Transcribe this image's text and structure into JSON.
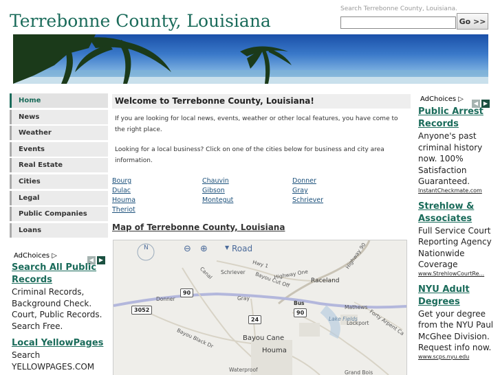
{
  "header": {
    "title": "Terrebonne County, Louisiana",
    "search_label": "Search Terrebonne County, Louisiana.",
    "search_value": "",
    "go_label": "Go >>"
  },
  "nav": {
    "items": [
      {
        "label": "Home",
        "active": true
      },
      {
        "label": "News"
      },
      {
        "label": "Weather"
      },
      {
        "label": "Events"
      },
      {
        "label": "Real Estate"
      },
      {
        "label": "Cities"
      },
      {
        "label": "Legal"
      },
      {
        "label": "Public Companies"
      },
      {
        "label": "Loans"
      }
    ]
  },
  "adchoices_label": "AdChoices",
  "left_ads": [
    {
      "title": "Search All Public Records",
      "body": "Criminal Records, Background Check. Court, Public Records. Search Free."
    },
    {
      "title": "Local YellowPages",
      "body": "Search YELLOWPAGES.COM"
    }
  ],
  "right_ads": [
    {
      "title": "Public Arrest Records",
      "body": "Anyone's past criminal history now. 100% Satisfaction Guaranteed.",
      "url": "InstantCheckmate.com"
    },
    {
      "title": "Strehlow & Associates",
      "body": "Full Service Court Reporting Agency Nationwide Coverage",
      "url": "www.StrehlowCourtRe..."
    },
    {
      "title": "NYU Adult Degrees",
      "body": "Get your degree from the NYU Paul McGhee Division. Request info now.",
      "url": "www.scps.nyu.edu"
    }
  ],
  "main": {
    "welcome": "Welcome to Terrebonne County, Louisiana!",
    "intro_1": "If you are looking for local news, events, weather or other local features, you have come to the right place.",
    "intro_2": "Looking for a local business? Click on one of the cities below for business and city area information.",
    "cities": [
      "Bourg",
      "Chauvin",
      "Donner",
      "Dulac",
      "Gibson",
      "Gray",
      "Houma",
      "Montegut",
      "Schriever",
      "Theriot"
    ],
    "map_title": "Map of Terrebonne County, Louisiana"
  },
  "map": {
    "road_label": "Road",
    "compass_n": "N",
    "labels": [
      "Schriever",
      "Highway One",
      "Bayou Cut Off",
      "Raceland",
      "Highway 90",
      "Donner",
      "Gray",
      "Bus",
      "Mathews",
      "Lake Fields",
      "Lockport",
      "Bayou Black Dr",
      "Bayou Cane",
      "Houma",
      "Waterproof",
      "Grand Bois",
      "Canal",
      "Hwy 1",
      "Forty Arpent Ca"
    ],
    "shields": [
      "90",
      "3052",
      "24",
      "90"
    ]
  }
}
